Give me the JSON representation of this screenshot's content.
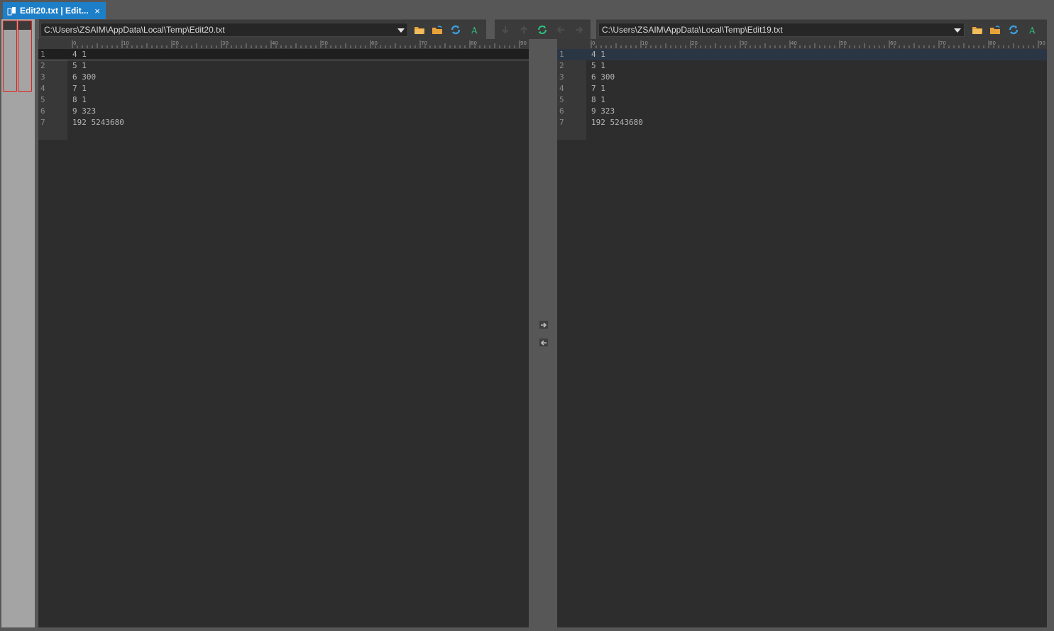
{
  "tab": {
    "title": "Edit20.txt | Edit...",
    "close": "×"
  },
  "left": {
    "path": "C:\\Users\\ZSAIM\\AppData\\Local\\Temp\\Edit20.txt",
    "lines": [
      {
        "n": "1",
        "t": "4 1"
      },
      {
        "n": "2",
        "t": "5 1"
      },
      {
        "n": "3",
        "t": "6 300"
      },
      {
        "n": "4",
        "t": "7 1"
      },
      {
        "n": "5",
        "t": "8 1"
      },
      {
        "n": "6",
        "t": "9 323"
      },
      {
        "n": "7",
        "t": "192 5243680"
      }
    ]
  },
  "right": {
    "path": "C:\\Users\\ZSAIM\\AppData\\Local\\Temp\\Edit19.txt",
    "lines": [
      {
        "n": "1",
        "t": "4 1"
      },
      {
        "n": "2",
        "t": "5 1"
      },
      {
        "n": "3",
        "t": "6 300"
      },
      {
        "n": "4",
        "t": "7 1"
      },
      {
        "n": "5",
        "t": "8 1"
      },
      {
        "n": "6",
        "t": "9 323"
      },
      {
        "n": "7",
        "t": "192 5243680"
      }
    ]
  },
  "ruler_labels": [
    "0",
    "10",
    "20",
    "30",
    "40",
    "50",
    "60",
    "70",
    "80",
    "90"
  ],
  "colors": {
    "tab_active": "#1e7fc9",
    "diff_marker": "#e0211b",
    "folder": "#e8a23a",
    "refresh": "#3aa0e0",
    "sync": "#2ec27e"
  }
}
